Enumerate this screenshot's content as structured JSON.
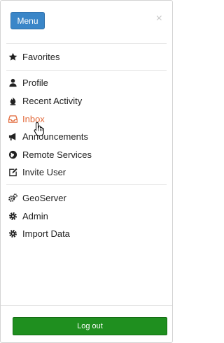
{
  "header": {
    "menu_label": "Menu",
    "close_glyph": "×"
  },
  "menu": {
    "favorites": "Favorites",
    "profile": "Profile",
    "recent_activity": "Recent Activity",
    "inbox": "Inbox",
    "announcements": "Announcements",
    "remote_services": "Remote Services",
    "invite_user": "Invite User",
    "geoserver": "GeoServer",
    "admin": "Admin",
    "import_data": "Import Data"
  },
  "footer": {
    "logout_label": "Log out"
  },
  "colors": {
    "menu_button": "#3a86c8",
    "logout_button": "#1f8f1f",
    "active_item": "#e26a3b"
  },
  "icons": {
    "favorites": "star-icon",
    "profile": "user-icon",
    "recent_activity": "flame-icon",
    "inbox": "inbox-icon",
    "announcements": "bullhorn-icon",
    "remote_services": "globe-icon",
    "invite_user": "edit-icon",
    "geoserver": "cogs-icon",
    "admin": "cog-icon",
    "import_data": "cog-icon"
  }
}
